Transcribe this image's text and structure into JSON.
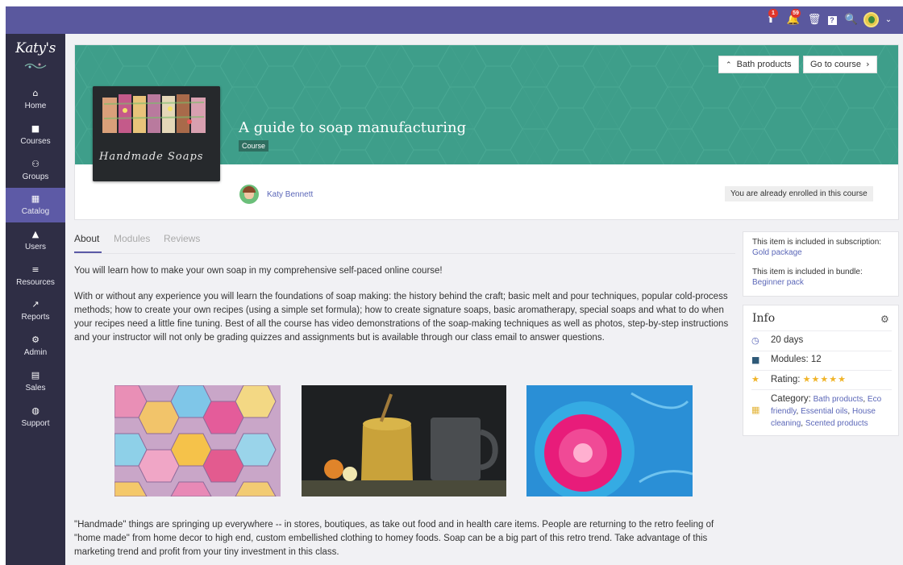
{
  "topbar": {
    "notification_count": "1",
    "announcement_count": "59",
    "icons": [
      "upload-icon",
      "bell-icon",
      "trash-icon",
      "help-icon",
      "search-icon",
      "avatar",
      "chevron-down-icon"
    ]
  },
  "sidebar": {
    "logo": "Katy's",
    "items": [
      {
        "label": "Home",
        "icon": "home-icon",
        "active": false
      },
      {
        "label": "Courses",
        "icon": "book-icon",
        "active": false
      },
      {
        "label": "Groups",
        "icon": "groups-icon",
        "active": false
      },
      {
        "label": "Catalog",
        "icon": "grid-icon",
        "active": true
      },
      {
        "label": "Users",
        "icon": "user-icon",
        "active": false
      },
      {
        "label": "Resources",
        "icon": "library-icon",
        "active": false
      },
      {
        "label": "Reports",
        "icon": "chart-icon",
        "active": false
      },
      {
        "label": "Admin",
        "icon": "gear-icon",
        "active": false
      },
      {
        "label": "Sales",
        "icon": "money-icon",
        "active": false
      },
      {
        "label": "Support",
        "icon": "globe-icon",
        "active": false
      }
    ]
  },
  "course": {
    "title": "A guide to soap manufacturing",
    "type": "Course",
    "image_caption": "Handmade Soaps",
    "author": "Katy Bennett",
    "enrolled_status": "You are already enrolled in this course",
    "back_button": "Bath products",
    "goto_button": "Go to course"
  },
  "tabs": [
    "About",
    "Modules",
    "Reviews"
  ],
  "about": {
    "intro": "You will learn how to make your own soap in my comprehensive self-paced online course!",
    "body": "With or without any experience you will learn the foundations of soap making: the history behind the craft; basic melt and pour techniques, popular cold-process methods; how to create your own recipes (using a simple set formula); how to create signature soaps, basic aromatherapy, special soaps and what to do when your recipes need a little fine tuning. Best of all the course has video demonstrations of the soap-making techniques as well as photos, step-by-step instructions and your instructor will not only be grading quizzes and assignments but is available through our class email to answer questions.",
    "closing": "\"Handmade\" things are springing up everywhere -- in stores, boutiques, as take out food and in health care items. People are returning to the retro feeling of \"home made\" from home decor to high end, custom embellished clothing to homey foods. Soap can be a big part of this retro trend. Take advantage of this marketing trend and profit from your tiny investment in this class."
  },
  "subscription": {
    "text": "This item is included in subscription:",
    "link": "Gold package",
    "bundle_text": "This item is included in bundle:",
    "bundle_link": "Beginner pack"
  },
  "info": {
    "title": "Info",
    "duration": "20 days",
    "modules": "Modules: 12",
    "rating_label": "Rating:",
    "rating": 5,
    "rating_stars": "★★★★★",
    "category_label": "Category:",
    "categories": [
      "Bath products",
      "Eco friendly",
      "Essential oils",
      "House cleaning",
      "Scented products"
    ]
  },
  "colors": {
    "topbar": "#5a589e",
    "sidebar": "#2f2e45",
    "sidebar_active": "#5d5aa6",
    "hero": "#3e9e8a",
    "link": "#5b67b8"
  }
}
